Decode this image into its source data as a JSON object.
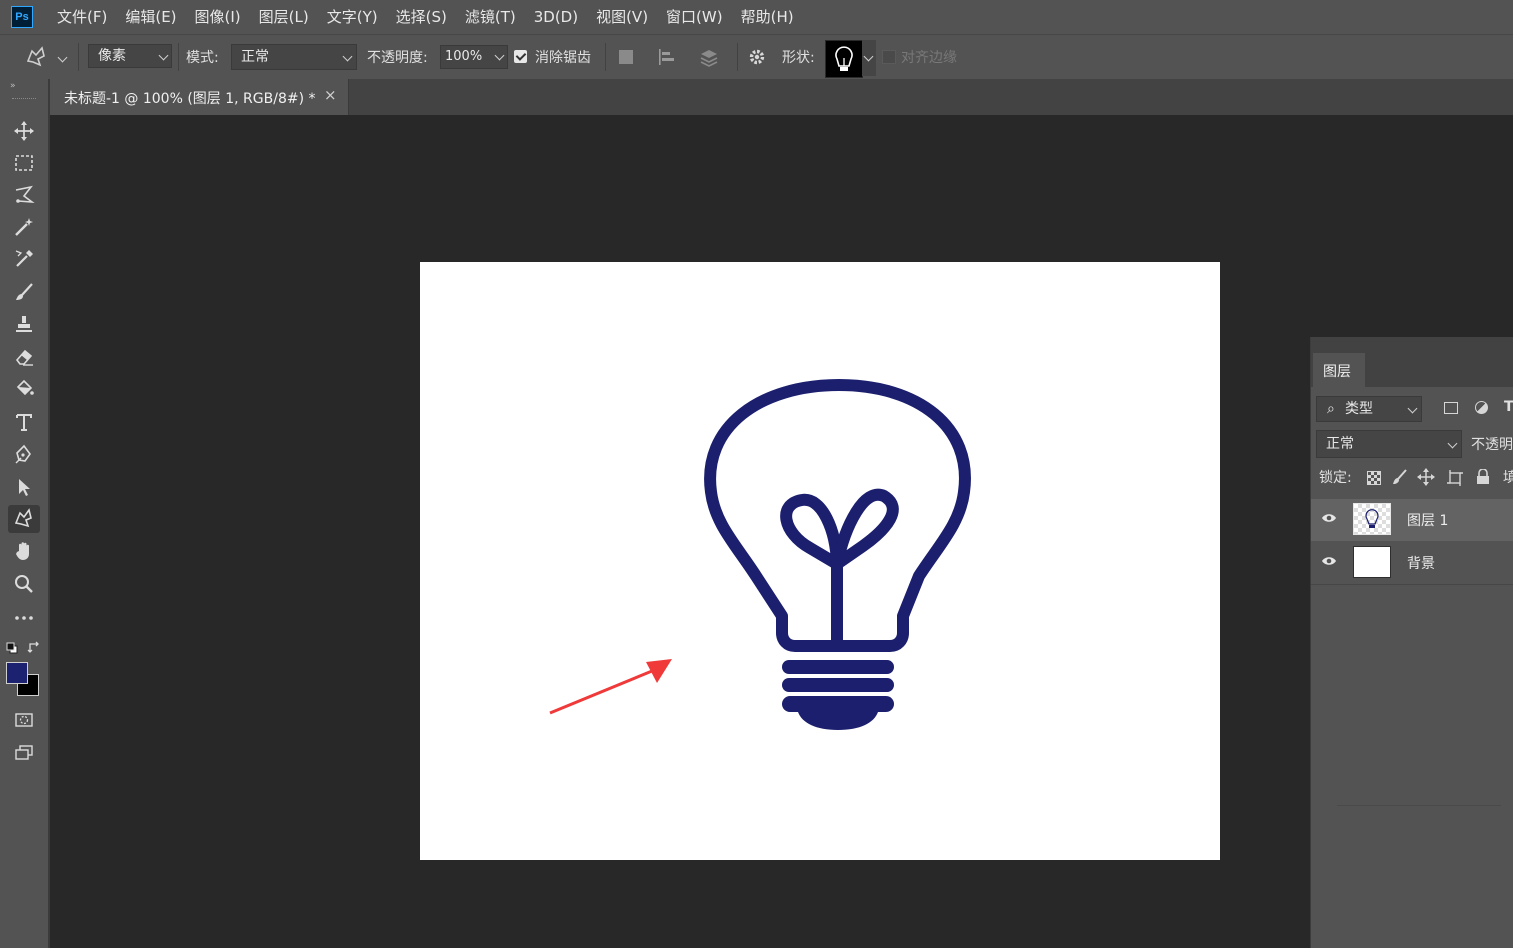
{
  "app": {
    "logo": "Ps",
    "accent": "#31a8ff"
  },
  "menu": [
    "文件(F)",
    "编辑(E)",
    "图像(I)",
    "图层(L)",
    "文字(Y)",
    "选择(S)",
    "滤镜(T)",
    "3D(D)",
    "视图(V)",
    "窗口(W)",
    "帮助(H)"
  ],
  "options": {
    "fill_type": "像素",
    "mode_label": "模式:",
    "mode_value": "正常",
    "opacity_label": "不透明度:",
    "opacity_value": "100%",
    "antialias_label": "消除锯齿",
    "antialias_checked": true,
    "shape_label": "形状:",
    "align_edges_label": "对齐边缘"
  },
  "document_tab": {
    "title": "未标题-1 @ 100% (图层 1, RGB/8#) *",
    "close": "×"
  },
  "colors": {
    "foreground": "#1c2270",
    "background": "#000000",
    "bulb": "#1b1f6e",
    "arrow": "#f03a3a"
  },
  "layers_panel": {
    "tab_label": "图层",
    "filter_label": "类型",
    "blend_mode": "正常",
    "opacity_label": "不透明",
    "lock_label": "锁定:",
    "fill_label": "填",
    "layers": [
      {
        "name": "图层 1",
        "selected": true,
        "visible": true
      },
      {
        "name": "背景",
        "selected": false,
        "visible": true
      }
    ]
  }
}
